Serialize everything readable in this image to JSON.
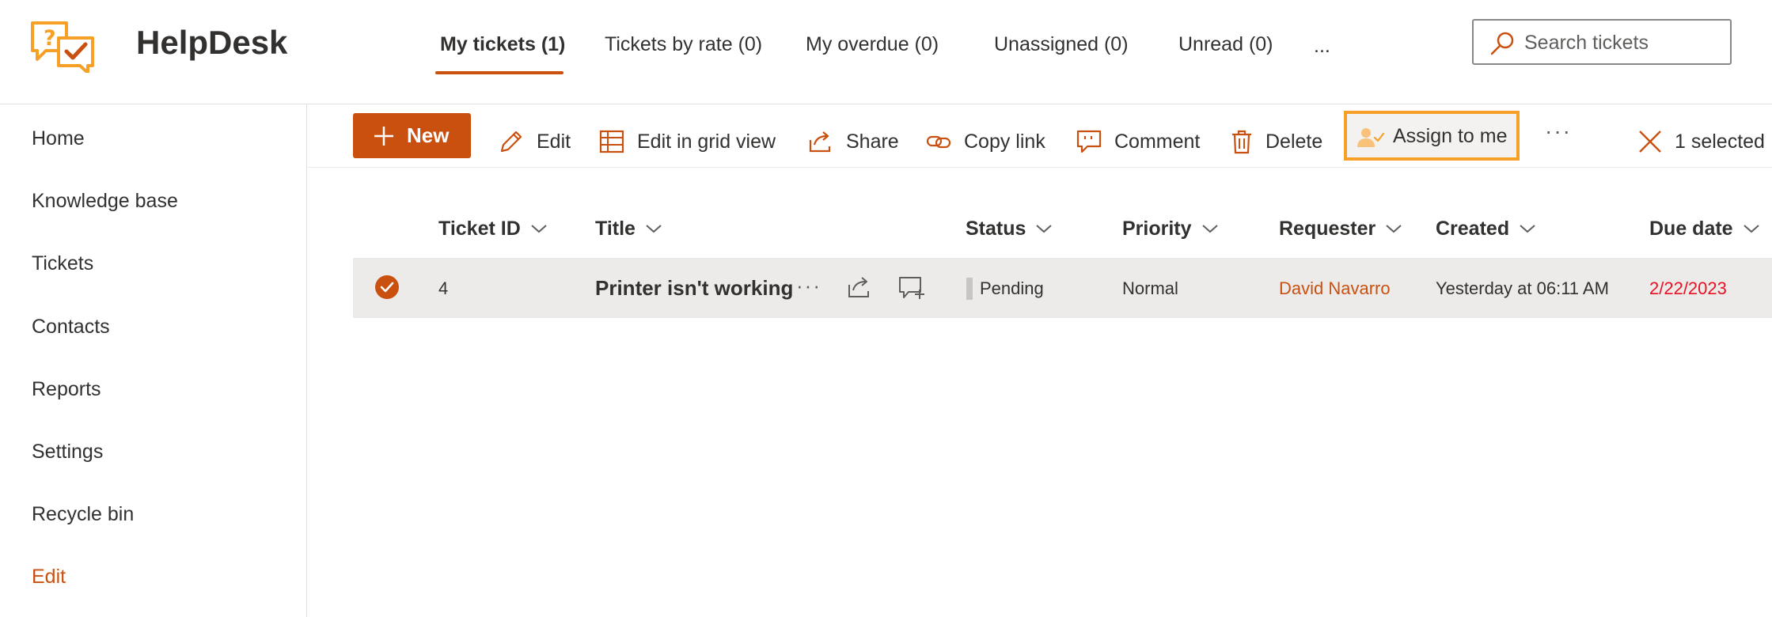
{
  "app": {
    "title": "HelpDesk"
  },
  "colors": {
    "accent": "#ca5010",
    "highlight_border": "#f7a027",
    "due_date": "#e81123"
  },
  "tabs": [
    {
      "label": "My tickets (1)",
      "active": true
    },
    {
      "label": "Tickets by rate (0)",
      "active": false
    },
    {
      "label": "My overdue (0)",
      "active": false
    },
    {
      "label": "Unassigned (0)",
      "active": false
    },
    {
      "label": "Unread (0)",
      "active": false
    },
    {
      "label": "...",
      "active": false
    }
  ],
  "search": {
    "placeholder": "Search tickets"
  },
  "sidebar": {
    "items": [
      {
        "label": "Home"
      },
      {
        "label": "Knowledge base"
      },
      {
        "label": "Tickets"
      },
      {
        "label": "Contacts"
      },
      {
        "label": "Reports"
      },
      {
        "label": "Settings"
      },
      {
        "label": "Recycle bin"
      },
      {
        "label": "Edit"
      }
    ]
  },
  "toolbar": {
    "new_label": "New",
    "edit_label": "Edit",
    "grid_label": "Edit in grid view",
    "share_label": "Share",
    "copy_link_label": "Copy link",
    "comment_label": "Comment",
    "delete_label": "Delete",
    "assign_label": "Assign to me",
    "more_label": "···",
    "selected_label": "1 selected"
  },
  "table": {
    "columns": [
      "Ticket ID",
      "Title",
      "Status",
      "Priority",
      "Requester",
      "Created",
      "Due date"
    ],
    "rows": [
      {
        "id": "4",
        "title": "Printer isn't working",
        "status": "Pending",
        "priority": "Normal",
        "requester": "David Navarro",
        "created": "Yesterday at 06:11 AM",
        "due": "2/22/2023"
      }
    ],
    "row_more": "···"
  }
}
